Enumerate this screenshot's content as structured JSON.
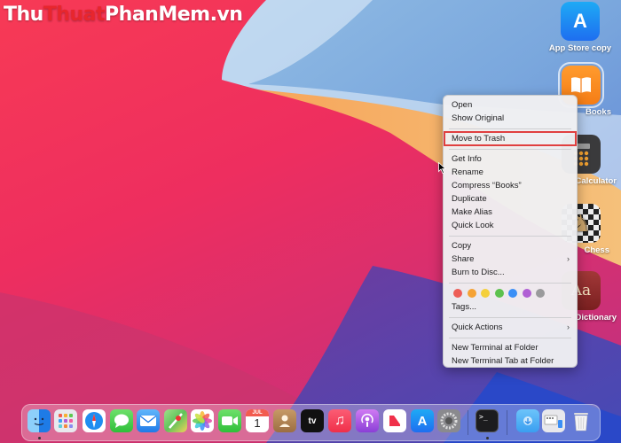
{
  "watermark": {
    "part1": "Thu",
    "part2": "Thuat",
    "part3": "PhanMem.vn"
  },
  "desktop_icons": [
    {
      "name": "app-store-copy",
      "label": "App Store copy",
      "glyph": "A"
    },
    {
      "name": "books",
      "label": "Books"
    },
    {
      "name": "calculator",
      "label": "Calculator"
    },
    {
      "name": "chess",
      "label": "Chess"
    },
    {
      "name": "dictionary",
      "label": "Dictionary",
      "glyph": "Aa"
    }
  ],
  "context_menu": {
    "group1": [
      "Open",
      "Show Original"
    ],
    "highlighted": "Move to Trash",
    "group3": [
      "Get Info",
      "Rename",
      "Compress “Books”",
      "Duplicate",
      "Make Alias",
      "Quick Look"
    ],
    "group4": {
      "copy": "Copy",
      "share": "Share",
      "burn": "Burn to Disc..."
    },
    "tag_colors": [
      "#ed5e57",
      "#f5a335",
      "#f4d03b",
      "#5dc14e",
      "#3b8ff6",
      "#b05fd4",
      "#9a9a9c"
    ],
    "tags_label": "Tags...",
    "quick_actions": "Quick Actions",
    "terminal_items": [
      "New Terminal at Folder",
      "New Terminal Tab at Folder"
    ],
    "submenu_arrow": "›"
  },
  "dock": {
    "calendar_month": "JUL",
    "calendar_day": "1",
    "tv_label": "tv",
    "terminal_prompt": ">_"
  }
}
